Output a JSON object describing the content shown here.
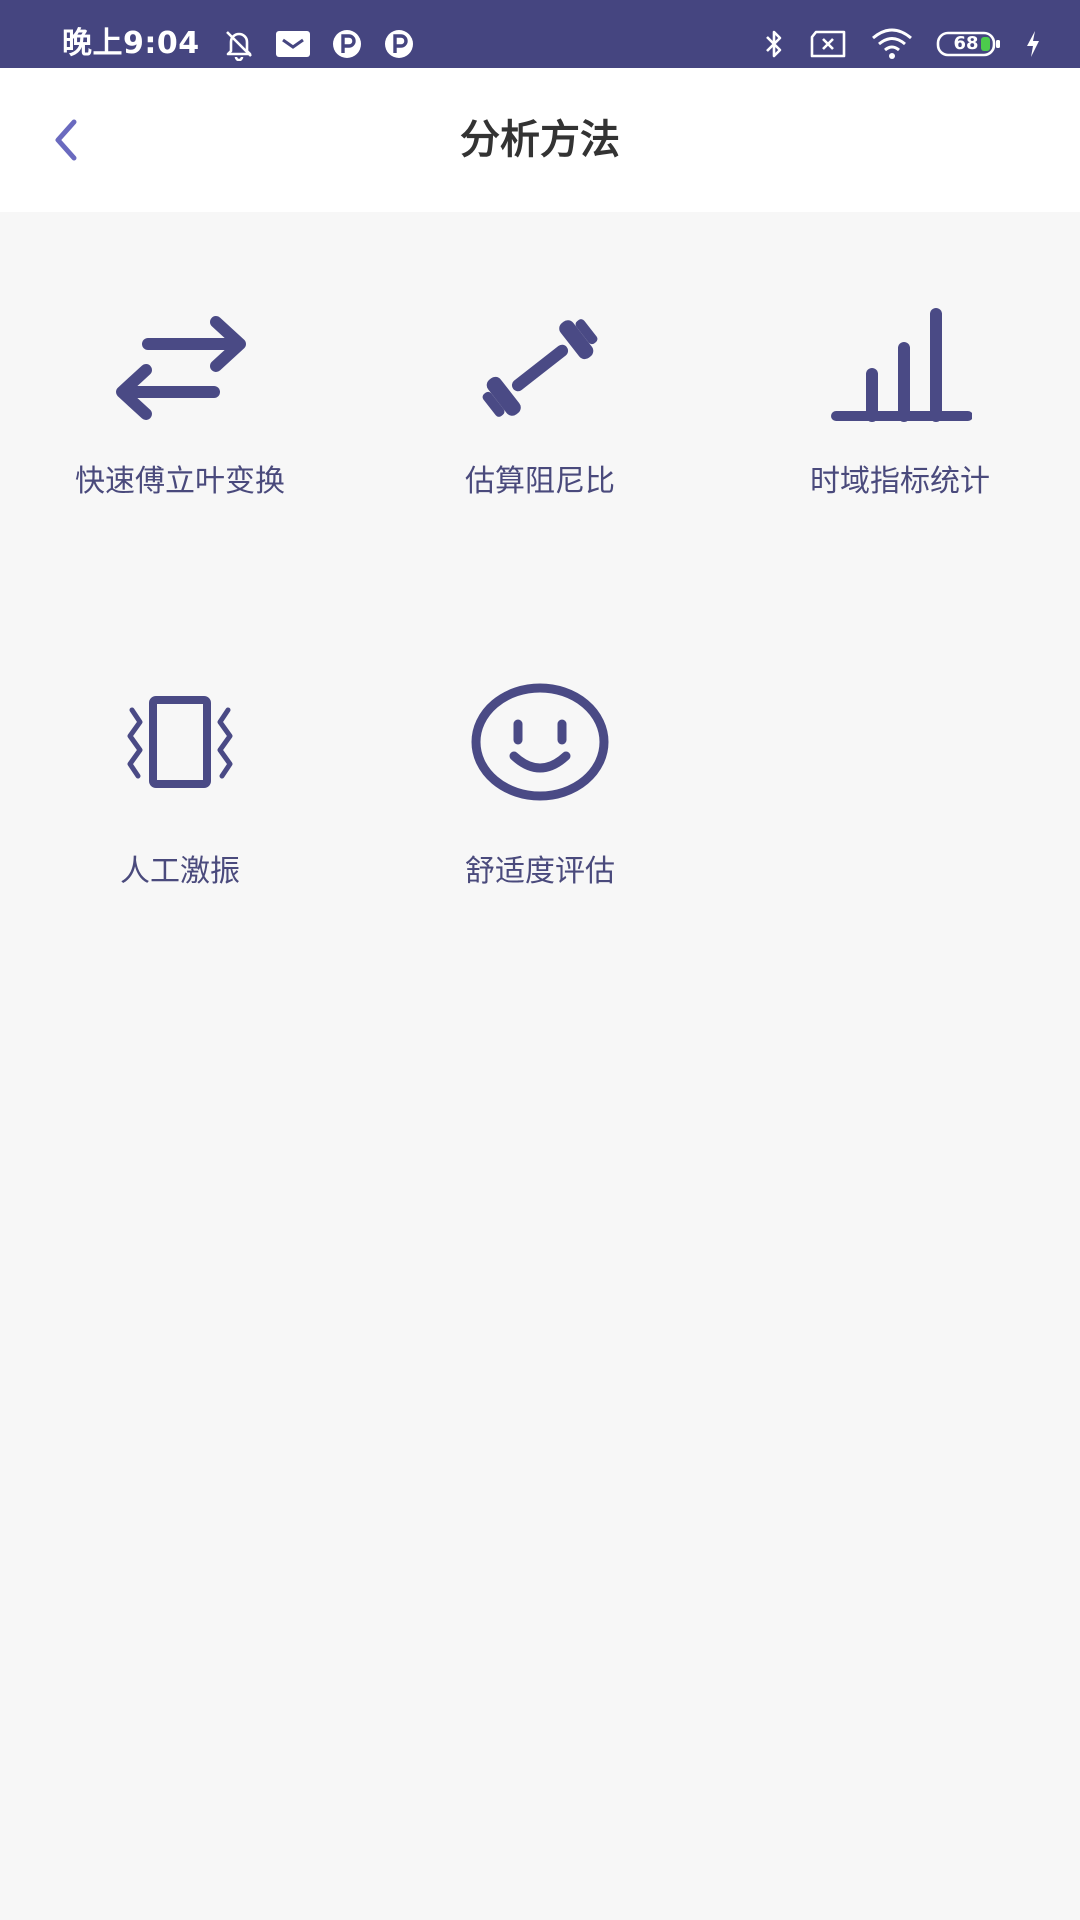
{
  "status_bar": {
    "time": "晚上9:04",
    "battery_level": "68",
    "left_icons": [
      "alarm-off-icon",
      "mail-icon",
      "p-app-icon",
      "p-app-icon"
    ],
    "right_icons": [
      "bluetooth-icon",
      "no-sim-icon",
      "wifi-icon",
      "battery-icon",
      "charging-icon"
    ]
  },
  "app_bar": {
    "title": "分析方法",
    "back_icon": "chevron-left-icon"
  },
  "methods": [
    {
      "label": "快速傅立叶变换",
      "icon": "swap-arrows-icon"
    },
    {
      "label": "估算阻尼比",
      "icon": "dumbbell-icon"
    },
    {
      "label": "时域指标统计",
      "icon": "bar-chart-icon"
    },
    {
      "label": "人工激振",
      "icon": "vibrate-icon"
    },
    {
      "label": "舒适度评估",
      "icon": "smiley-icon"
    }
  ],
  "colors": {
    "status_bar": "#454580",
    "accent": "#4a4a85",
    "label": "#4a4a7c",
    "back_arrow": "#6a6abf",
    "background": "#f7f7f7"
  }
}
